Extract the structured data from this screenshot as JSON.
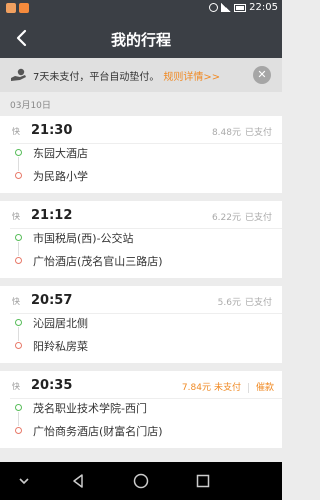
{
  "status_bar": {
    "time": "22:05"
  },
  "header": {
    "title": "我的行程"
  },
  "notice": {
    "text": "7天未支付，平台自动垫付。",
    "link": "规则详情>>",
    "close_glyph": "✕"
  },
  "date_label": "03月10日",
  "trips": [
    {
      "type": "快",
      "time": "21:30",
      "price": "8.48元",
      "status": "已支付",
      "from": "东园大酒店",
      "to": "为民路小学"
    },
    {
      "type": "快",
      "time": "21:12",
      "price": "6.22元",
      "status": "已支付",
      "from": "市国税局(西)-公交站",
      "to": "广怡酒店(茂名官山三路店)"
    },
    {
      "type": "快",
      "time": "20:57",
      "price": "5.6元",
      "status": "已支付",
      "from": "沁园居北侧",
      "to": "阳羚私房菜"
    },
    {
      "type": "快",
      "time": "20:35",
      "price": "7.84元",
      "status": "未支付",
      "action": "催款",
      "from": "茂名职业技术学院-西门",
      "to": "广怡商务酒店(财富名门店)"
    }
  ],
  "colors": {
    "header_bg": "#3b3f45",
    "accent": "#f08a24",
    "start_dot": "#58bd5a",
    "end_dot": "#e87a6a"
  },
  "icons": {
    "back": "back-arrow-icon",
    "notice": "hand-coin-icon",
    "close": "close-icon"
  }
}
